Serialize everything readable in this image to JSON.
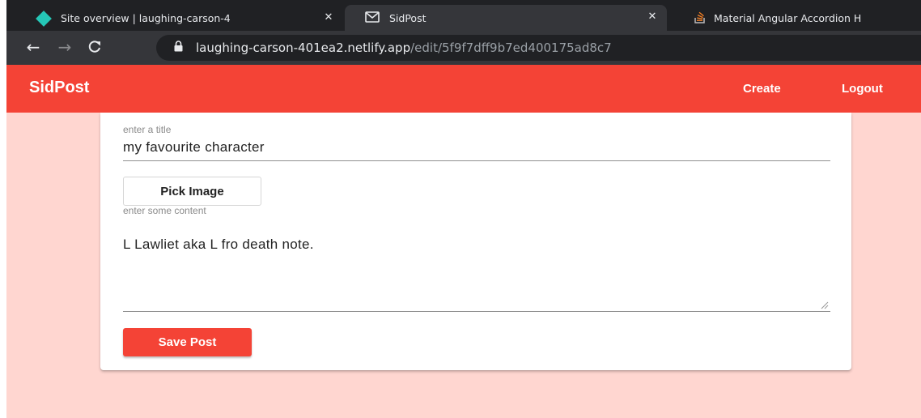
{
  "browser": {
    "tabs": [
      {
        "title": "Site overview | laughing-carson-4",
        "close": "✕",
        "favicon": "netlify-icon"
      },
      {
        "title": "SidPost",
        "close": "✕",
        "favicon": "mail-icon",
        "active": true
      },
      {
        "title": "Material Angular Accordion H",
        "favicon": "stackoverflow-icon"
      }
    ],
    "url_host": "laughing-carson-401ea2.netlify.app",
    "url_path": "/edit/5f9f7dff9b7ed400175ad8c7",
    "icons": {
      "back": "←",
      "forward": "→",
      "reload": "C"
    }
  },
  "app": {
    "brand": "SidPost",
    "nav": {
      "create": "Create",
      "logout": "Logout"
    },
    "colors": {
      "primary": "#f44336",
      "page_background": "#ffd6d0"
    }
  },
  "form": {
    "title_placeholder": "enter a title",
    "title_value": "my favourite character",
    "pick_image_label": "Pick Image",
    "content_placeholder": "enter some content",
    "content_value": "L Lawliet aka L fro death note.",
    "save_label": "Save Post"
  }
}
